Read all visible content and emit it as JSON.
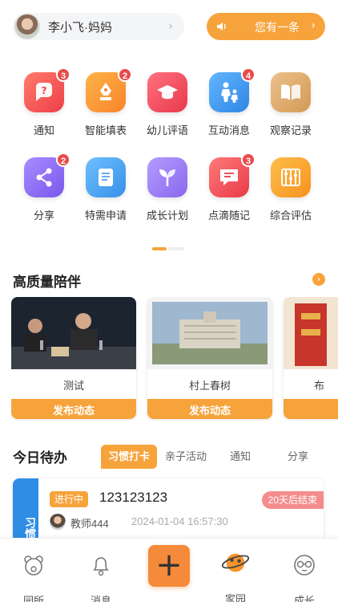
{
  "header": {
    "user_name": "李小飞·妈妈",
    "user_chevron": "›",
    "notice_text": "您有一条",
    "notice_chevron": "›"
  },
  "grid": [
    {
      "label": "通知",
      "icon": "notification-icon",
      "badge": "3",
      "color": "#f04d4d"
    },
    {
      "label": "智能填表",
      "icon": "form-pen-icon",
      "badge": "2",
      "color": "#f7932b"
    },
    {
      "label": "幼儿评语",
      "icon": "graduation-cap-icon",
      "badge": "",
      "color": "#ee4a5a"
    },
    {
      "label": "互动消息",
      "icon": "parent-child-icon",
      "badge": "4",
      "color": "#3b96ec"
    },
    {
      "label": "观察记录",
      "icon": "open-book-icon",
      "badge": "",
      "color": "#dba360"
    },
    {
      "label": "分享",
      "icon": "share-icon",
      "badge": "2",
      "color": "#8b6ef0"
    },
    {
      "label": "特需申请",
      "icon": "scroll-icon",
      "badge": "",
      "color": "#3c9be7"
    },
    {
      "label": "成长计划",
      "icon": "sprout-icon",
      "badge": "",
      "color": "#9a78ef"
    },
    {
      "label": "点滴随记",
      "icon": "note-icon",
      "badge": "3",
      "color": "#ee4b53"
    },
    {
      "label": "综合评估",
      "icon": "abacus-icon",
      "badge": "",
      "color": "#f7a12b"
    }
  ],
  "quality": {
    "title": "高质量陪伴",
    "more": "›",
    "cards": [
      {
        "title": "测试",
        "button": "发布动态"
      },
      {
        "title": "村上春树",
        "button": "发布动态"
      },
      {
        "title": "布",
        "button": ""
      }
    ]
  },
  "todo": {
    "title": "今日待办",
    "tabs": [
      "习惯打卡",
      "亲子活动",
      "通知",
      "分享"
    ],
    "card": {
      "side_label": "习惯",
      "status": "进行中",
      "name": "123123123",
      "end": "20天后结束",
      "teacher": "教师444",
      "time": "2024-01-04 16:57:30"
    }
  },
  "nav": [
    {
      "label": "园所",
      "icon": "bear-face-icon"
    },
    {
      "label": "消息",
      "icon": "bell-icon"
    },
    {
      "label": "",
      "icon": "plus-icon"
    },
    {
      "label": "家园",
      "icon": "planet-icon"
    },
    {
      "label": "成长",
      "icon": "glasses-face-icon"
    }
  ],
  "colors": {
    "accent": "#f7a33b",
    "blue": "#2f8de4",
    "badge": "#e94b4b"
  }
}
